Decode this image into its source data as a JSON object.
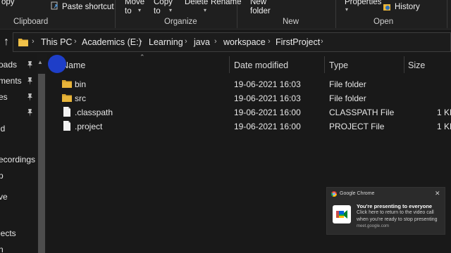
{
  "ribbon": {
    "copy_label": "opy",
    "paste_shortcut_label": "Paste shortcut",
    "move_to_label": "Move to",
    "copy_to_label": "Copy to",
    "delete_label": "Delete",
    "rename_label": "Rename",
    "new_folder_label": "New folder",
    "properties_label": "Properties",
    "history_label": "History",
    "groups": [
      "Clipboard",
      "Organize",
      "New",
      "Open"
    ]
  },
  "address_bar": {
    "crumbs": [
      "This PC",
      "Academics (E:)",
      "Learning",
      "java",
      "workspace",
      "FirstProject"
    ]
  },
  "nav_pane": {
    "items": [
      "oads",
      "ments",
      "es",
      "id",
      "ecordings",
      "p",
      "ve",
      "jects",
      "n"
    ]
  },
  "columns": {
    "name": "Name",
    "date_modified": "Date modified",
    "type": "Type",
    "size": "Size"
  },
  "files": [
    {
      "name": "bin",
      "date": "19-06-2021 16:03",
      "type": "File folder",
      "size": "",
      "icon": "folder-icon"
    },
    {
      "name": "src",
      "date": "19-06-2021 16:03",
      "type": "File folder",
      "size": "",
      "icon": "folder-icon"
    },
    {
      "name": ".classpath",
      "date": "19-06-2021 16:00",
      "type": "CLASSPATH File",
      "size": "1 KB",
      "icon": "file-icon"
    },
    {
      "name": ".project",
      "date": "19-06-2021 16:00",
      "type": "PROJECT File",
      "size": "1 KB",
      "icon": "file-icon"
    }
  ],
  "toast": {
    "app": "Google Chrome",
    "title": "You're presenting to everyone",
    "body": "Click here to return to the video call when you're ready to stop presenting",
    "source": "meet.google.com"
  },
  "colors": {
    "folder": "#e8b53a",
    "accent": "#1e3ec8"
  }
}
